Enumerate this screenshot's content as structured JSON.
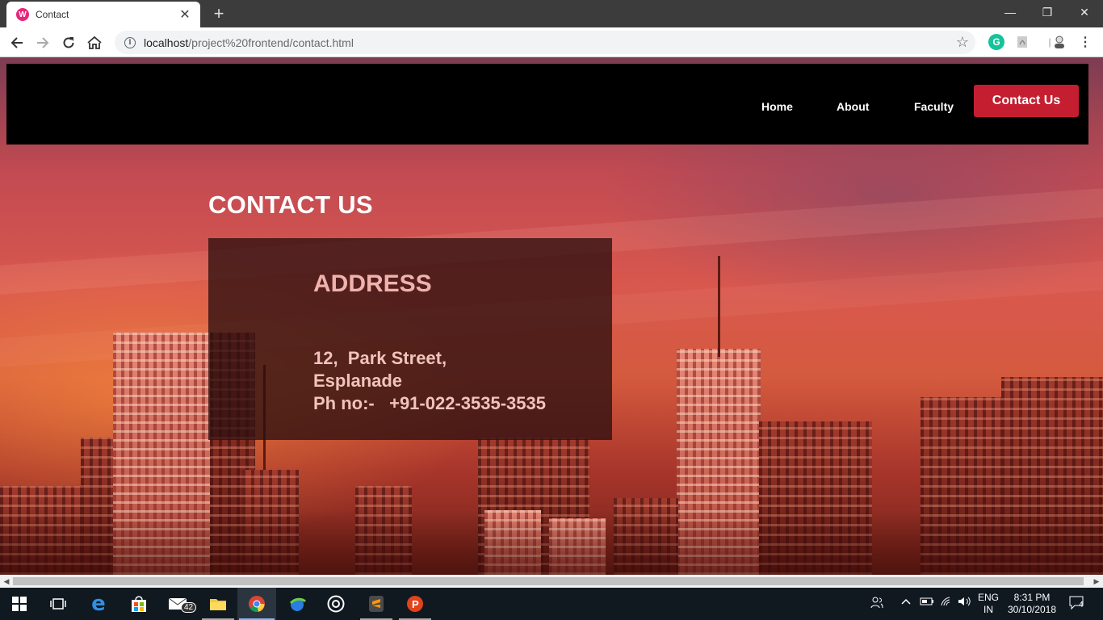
{
  "browser": {
    "tab_title": "Contact",
    "tab_favicon_letter": "W",
    "new_tab_symbol": "+",
    "close_symbol": "✕",
    "url_host": "localhost",
    "url_path": "/project%20frontend/contact.html",
    "window_controls": {
      "minimize": "—",
      "restore": "❐",
      "close": "✕"
    },
    "extensions": {
      "grammarly": "G"
    }
  },
  "site": {
    "nav": {
      "home": "Home",
      "about": "About",
      "faculty": "Faculty",
      "contact": "Contact Us"
    },
    "heading": "CONTACT US",
    "address": {
      "title": "ADDRESS",
      "line1": "12,  Park Street,",
      "line2": "Esplanade",
      "line3": "Ph no:-   +91-022-3535-3535"
    }
  },
  "taskbar": {
    "mail_badge": "42",
    "lang_top": "ENG",
    "lang_bottom": "IN",
    "time": "8:31 PM",
    "date": "30/10/2018",
    "notification_count": "4"
  },
  "colors": {
    "nav_background": "#000000",
    "cta_background": "#c41e30",
    "card_background": "rgba(45,15,15,0.78)",
    "taskbar": "#101820"
  }
}
